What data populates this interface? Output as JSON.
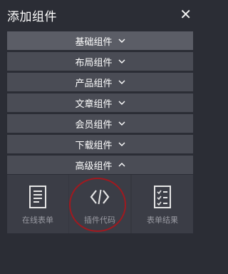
{
  "header": {
    "title": "添加组件",
    "close_icon": "close-x-icon"
  },
  "categories": [
    {
      "label": "基础组件",
      "state": "collapsed"
    },
    {
      "label": "布局组件",
      "state": "collapsed"
    },
    {
      "label": "产品组件",
      "state": "collapsed"
    },
    {
      "label": "文章组件",
      "state": "collapsed"
    },
    {
      "label": "会员组件",
      "state": "collapsed"
    },
    {
      "label": "下载组件",
      "state": "collapsed"
    },
    {
      "label": "高级组件",
      "state": "expanded"
    }
  ],
  "advanced_items": [
    {
      "label": "在线表单",
      "icon": "form-document-icon"
    },
    {
      "label": "插件代码",
      "icon": "code-brackets-icon",
      "highlighted": true
    },
    {
      "label": "表单结果",
      "icon": "form-results-checklist-icon"
    }
  ],
  "colors": {
    "background": "#2b2d35",
    "category_bar": "#4a4c55",
    "tile": "#3b3d46",
    "highlight_ring": "#a1191f"
  }
}
